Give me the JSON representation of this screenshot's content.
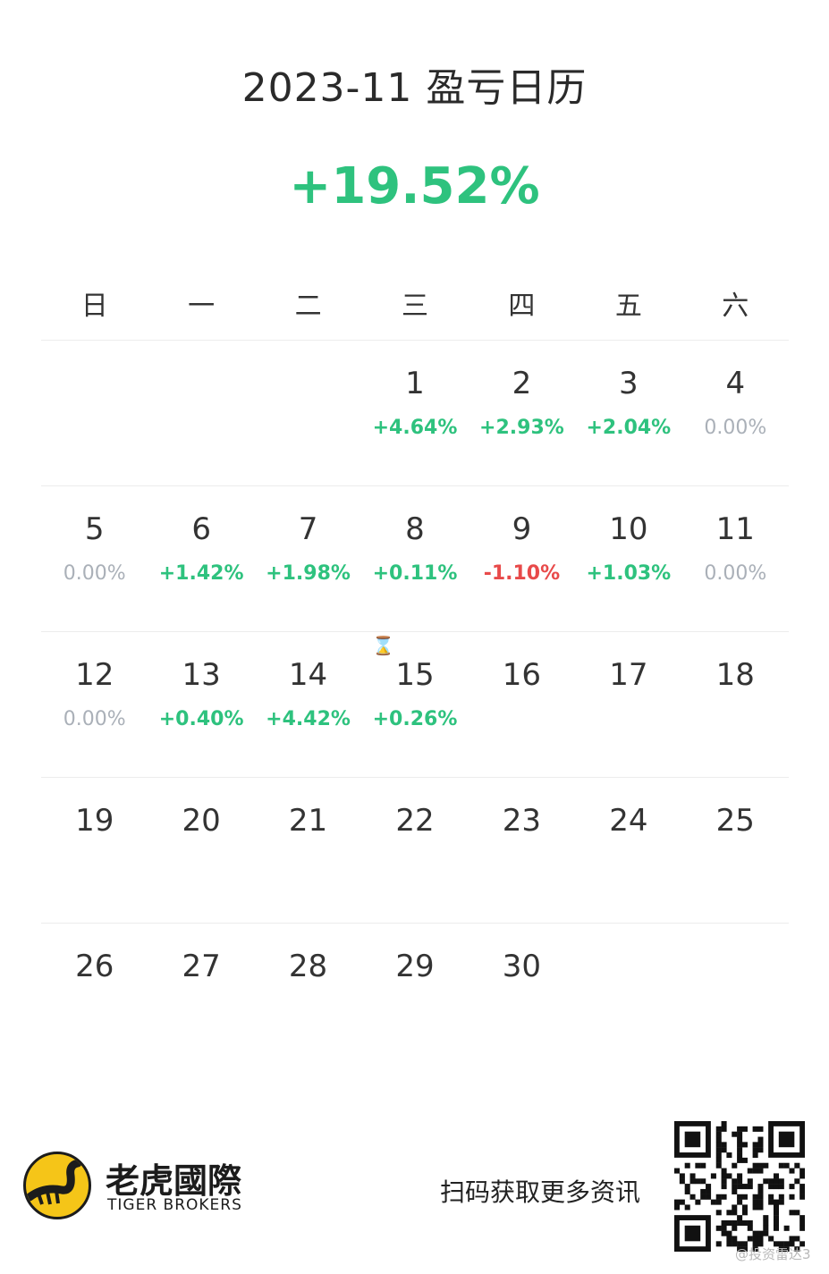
{
  "header": {
    "title": "2023-11 盈亏日历",
    "total_return": "+19.52%"
  },
  "colors": {
    "positive": "#2ec27e",
    "negative": "#e84a4a",
    "zero": "#aab0b8"
  },
  "weekdays": [
    "日",
    "一",
    "二",
    "三",
    "四",
    "五",
    "六"
  ],
  "weeks": [
    [
      {
        "day": "",
        "pct": "",
        "kind": ""
      },
      {
        "day": "",
        "pct": "",
        "kind": ""
      },
      {
        "day": "",
        "pct": "",
        "kind": ""
      },
      {
        "day": "1",
        "pct": "+4.64%",
        "kind": "pos"
      },
      {
        "day": "2",
        "pct": "+2.93%",
        "kind": "pos"
      },
      {
        "day": "3",
        "pct": "+2.04%",
        "kind": "pos"
      },
      {
        "day": "4",
        "pct": "0.00%",
        "kind": "zero"
      }
    ],
    [
      {
        "day": "5",
        "pct": "0.00%",
        "kind": "zero"
      },
      {
        "day": "6",
        "pct": "+1.42%",
        "kind": "pos"
      },
      {
        "day": "7",
        "pct": "+1.98%",
        "kind": "pos"
      },
      {
        "day": "8",
        "pct": "+0.11%",
        "kind": "pos"
      },
      {
        "day": "9",
        "pct": "-1.10%",
        "kind": "neg"
      },
      {
        "day": "10",
        "pct": "+1.03%",
        "kind": "pos"
      },
      {
        "day": "11",
        "pct": "0.00%",
        "kind": "zero"
      }
    ],
    [
      {
        "day": "12",
        "pct": "0.00%",
        "kind": "zero"
      },
      {
        "day": "13",
        "pct": "+0.40%",
        "kind": "pos"
      },
      {
        "day": "14",
        "pct": "+4.42%",
        "kind": "pos"
      },
      {
        "day": "15",
        "pct": "+0.26%",
        "kind": "pos"
      },
      {
        "day": "16",
        "pct": "",
        "kind": ""
      },
      {
        "day": "17",
        "pct": "",
        "kind": ""
      },
      {
        "day": "18",
        "pct": "",
        "kind": ""
      }
    ],
    [
      {
        "day": "19",
        "pct": "",
        "kind": ""
      },
      {
        "day": "20",
        "pct": "",
        "kind": ""
      },
      {
        "day": "21",
        "pct": "",
        "kind": ""
      },
      {
        "day": "22",
        "pct": "",
        "kind": ""
      },
      {
        "day": "23",
        "pct": "",
        "kind": ""
      },
      {
        "day": "24",
        "pct": "",
        "kind": ""
      },
      {
        "day": "25",
        "pct": "",
        "kind": ""
      }
    ],
    [
      {
        "day": "26",
        "pct": "",
        "kind": ""
      },
      {
        "day": "27",
        "pct": "",
        "kind": ""
      },
      {
        "day": "28",
        "pct": "",
        "kind": ""
      },
      {
        "day": "29",
        "pct": "",
        "kind": ""
      },
      {
        "day": "30",
        "pct": "",
        "kind": ""
      },
      {
        "day": "",
        "pct": "",
        "kind": ""
      },
      {
        "day": "",
        "pct": "",
        "kind": ""
      }
    ]
  ],
  "icons": {
    "hourglass": "hourglass-icon",
    "logo": "tiger-logo-icon",
    "qr": "qr-code-icon"
  },
  "footer": {
    "brand_cn": "老虎國際",
    "brand_en": "TIGER BROKERS",
    "scan_text": "扫码获取更多资讯",
    "watermark": "@投资雷达3"
  }
}
